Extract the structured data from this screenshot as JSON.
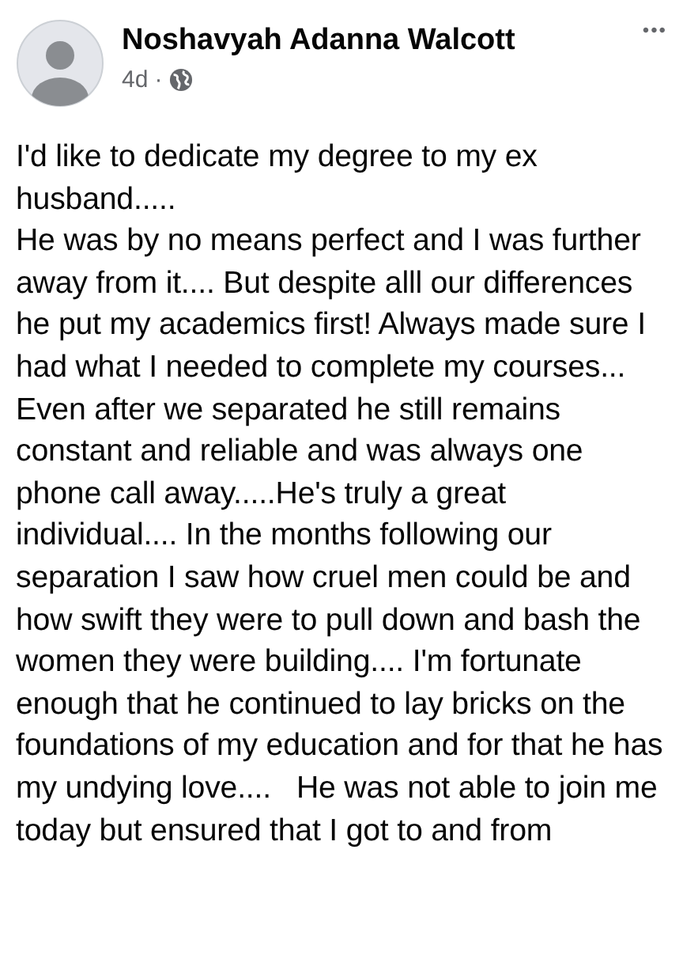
{
  "post": {
    "author": "Noshavyah Adanna Walcott",
    "time": "4d",
    "separator": "·",
    "more": "•••",
    "paragraphs": [
      "I'd like to dedicate my degree to my ex husband.....",
      "He was by no means perfect and I was further away from it.... But despite alll our differences he put my academics first! Always made sure I had what I needed to complete my courses... Even after we separated he still remains constant and reliable and was always one phone call away.....He's truly a great individual.... In the months following our separation I saw how cruel men could be and how swift they were to pull down and bash the women they were building.... I'm fortunate enough that he continued to lay bricks on the foundations of my education and for that he has my undying love....   He was not able to join me today but ensured that I got to and from"
    ]
  }
}
